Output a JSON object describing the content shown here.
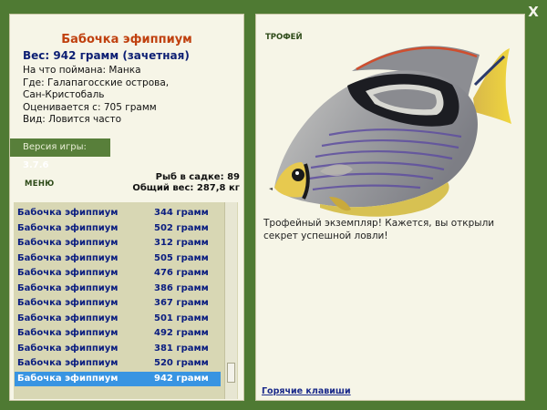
{
  "window": {
    "close_label": "X"
  },
  "fish": {
    "name": "Бабочка эфиппиум",
    "weight_line": "Вес: 942 грамм (зачетная)",
    "details": [
      "На что поймана: Манка",
      "Где: Галапагосские острова,",
      "Сан-Кристобаль",
      "Оценивается с: 705 грамм",
      "Вид: Ловится часто"
    ]
  },
  "version": {
    "label": "Версия игры:",
    "value": "3.7.6"
  },
  "menu": {
    "label": "МЕНЮ"
  },
  "stats": {
    "fish_in_keepnet": "Рыб в садке: 89",
    "total_weight": "Общий вес: 287,8 кг"
  },
  "catch_list": [
    {
      "name": "Бабочка эфиппиум",
      "weight": "344 грамм"
    },
    {
      "name": "Бабочка эфиппиум",
      "weight": "502 грамм"
    },
    {
      "name": "Бабочка эфиппиум",
      "weight": "312 грамм"
    },
    {
      "name": "Бабочка эфиппиум",
      "weight": "505 грамм"
    },
    {
      "name": "Бабочка эфиппиум",
      "weight": "476 грамм"
    },
    {
      "name": "Бабочка эфиппиум",
      "weight": "386 грамм"
    },
    {
      "name": "Бабочка эфиппиум",
      "weight": "367 грамм"
    },
    {
      "name": "Бабочка эфиппиум",
      "weight": "501 грамм"
    },
    {
      "name": "Бабочка эфиппиум",
      "weight": "492 грамм"
    },
    {
      "name": "Бабочка эфиппиум",
      "weight": "381 грамм"
    },
    {
      "name": "Бабочка эфиппиум",
      "weight": "520 грамм"
    },
    {
      "name": "Бабочка эфиппиум",
      "weight": "942 грамм"
    }
  ],
  "selected_index": 11,
  "trophy": {
    "label": "ТРОФЕЙ",
    "text": "Трофейный экземпляр! Кажется, вы открыли секрет успешной ловли!"
  },
  "hotkeys_label": "Горячие клавиши",
  "colors": {
    "background": "#4f7a33",
    "panel": "#f6f5e7",
    "title": "#c0410f",
    "list_text": "#0a1d80",
    "selection": "#3894e2"
  }
}
